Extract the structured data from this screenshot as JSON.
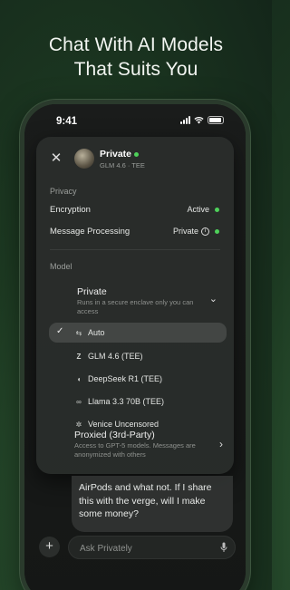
{
  "headline": [
    "Chat With AI Models",
    "That Suits You"
  ],
  "status_bar": {
    "time": "9:41"
  },
  "header": {
    "title": "Private",
    "subtitle": "GLM 4.6 · TEE"
  },
  "privacy": {
    "label": "Privacy",
    "rows": [
      {
        "label": "Encryption",
        "value": "Active"
      },
      {
        "label": "Message Processing",
        "value": "Private"
      }
    ]
  },
  "model": {
    "label": "Model",
    "private_option": {
      "title": "Private",
      "description": "Runs in a secure enclave only you can access"
    },
    "options": [
      {
        "label": "Auto",
        "icon": "shuffle-icon",
        "selected": true
      },
      {
        "label": "GLM 4.6 (TEE)",
        "icon": "z-logo-icon"
      },
      {
        "label": "DeepSeek R1 (TEE)",
        "icon": "whale-icon"
      },
      {
        "label": "Llama 3.3 70B (TEE)",
        "icon": "infinity-icon"
      },
      {
        "label": "Venice Uncensored",
        "icon": "venice-icon"
      }
    ],
    "proxied_option": {
      "title": "Proxied (3rd-Party)",
      "description": "Access to GPT-5 models. Messages are anonymized with others"
    }
  },
  "chat": {
    "message": "AirPods and what not. If I share this with the verge, will I make some money?"
  },
  "composer": {
    "placeholder": "Ask Privately"
  },
  "colors": {
    "status_dot": "#4ed15a",
    "background": "#1d3a22"
  }
}
